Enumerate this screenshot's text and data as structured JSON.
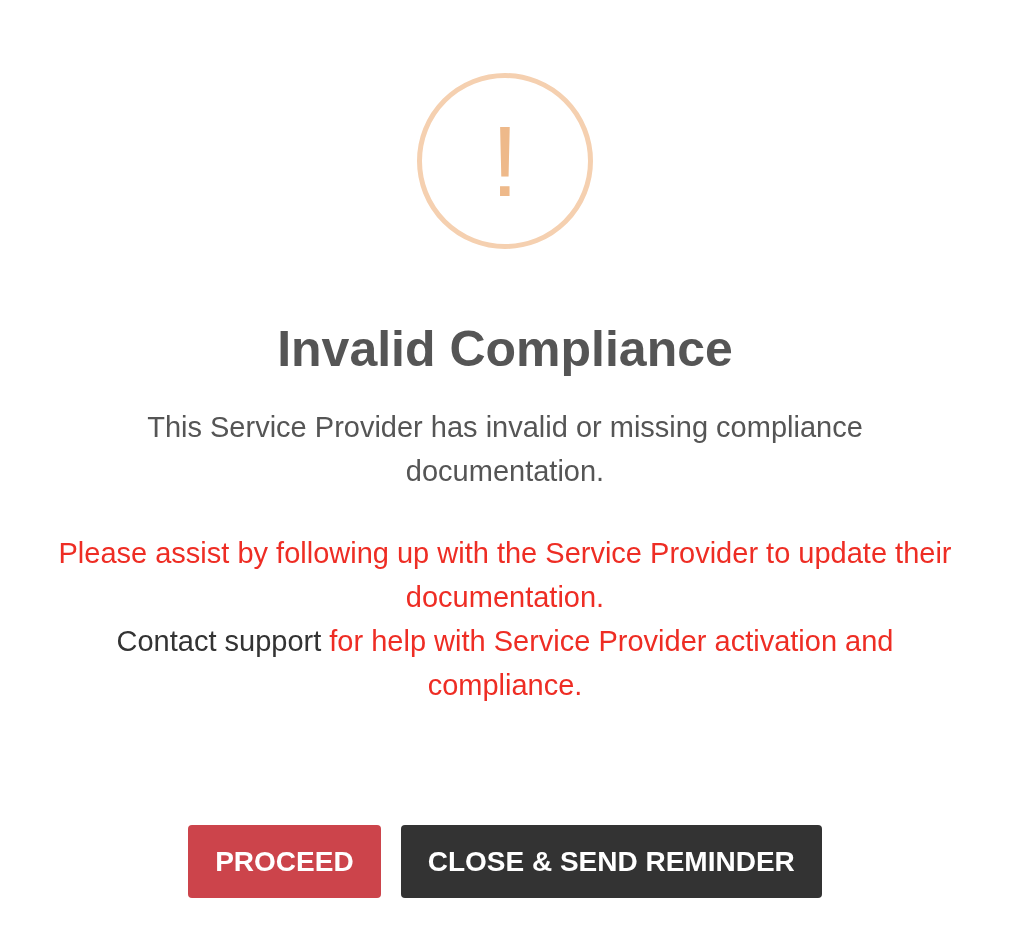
{
  "dialog": {
    "icon": "!",
    "title": "Invalid Compliance",
    "message": "This Service Provider has invalid or missing compliance documentation.",
    "alert": "Please assist by following up with the Service Provider to update their documentation.",
    "support": {
      "link": "Contact support",
      "text": "for help with Service Provider activation and compliance."
    },
    "buttons": [
      {
        "label": "PROCEED",
        "kind": "danger"
      },
      {
        "label": "CLOSE & SEND REMINDER",
        "kind": "dark"
      }
    ]
  }
}
